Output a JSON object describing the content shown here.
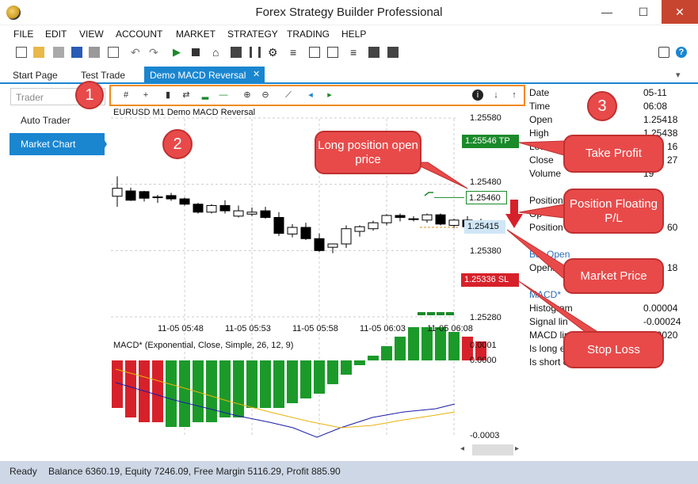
{
  "window": {
    "title": "Forex Strategy Builder Professional",
    "minimize": "—",
    "maximize": "☐",
    "close": "✕"
  },
  "menu": [
    "FILE",
    "EDIT",
    "VIEW",
    "ACCOUNT",
    "MARKET",
    "STRATEGY",
    "TRADING",
    "HELP"
  ],
  "tabs": {
    "start": "Start Page",
    "test": "Test Trade",
    "active": "Demo MACD Reversal",
    "close": "✕",
    "dropdown": "▾"
  },
  "sidebar": {
    "search_placeholder": "Trader",
    "items": [
      "Auto Trader",
      "Market Chart"
    ]
  },
  "chart": {
    "title": "EURUSD  M1 Demo MACD Reversal",
    "price_ticks": [
      "1.25580",
      "1.25480",
      "1.25380",
      "1.25280"
    ],
    "time_ticks": [
      "11-05 05:48",
      "11-05 05:53",
      "11-05 05:58",
      "11-05 06:03",
      "11-05 06:08"
    ],
    "tp_label": "1.25546 TP",
    "position_label": "1.25460",
    "market_label": "1.25415",
    "sl_label": "1.25336 SL",
    "indicator_title": "MACD* (Exponential, Close, Simple, 26, 12, 9)",
    "indicator_ticks": [
      "0.0001",
      "0.0000",
      "-0.0003"
    ]
  },
  "chart_data": {
    "type": "candlestick",
    "title": "EURUSD  M1 Demo MACD Reversal",
    "ylim": [
      1.2528,
      1.2558
    ],
    "candles": [
      {
        "o": 1.25462,
        "h": 1.25492,
        "l": 1.25446,
        "c": 1.25474
      },
      {
        "o": 1.2547,
        "h": 1.25475,
        "l": 1.25455,
        "c": 1.25456
      },
      {
        "o": 1.25469,
        "h": 1.2547,
        "l": 1.25454,
        "c": 1.25459
      },
      {
        "o": 1.2546,
        "h": 1.25464,
        "l": 1.25452,
        "c": 1.25461
      },
      {
        "o": 1.25463,
        "h": 1.25467,
        "l": 1.25455,
        "c": 1.25458
      },
      {
        "o": 1.25458,
        "h": 1.2546,
        "l": 1.25448,
        "c": 1.2545
      },
      {
        "o": 1.2545,
        "h": 1.25452,
        "l": 1.25436,
        "c": 1.25438
      },
      {
        "o": 1.25438,
        "h": 1.2545,
        "l": 1.25436,
        "c": 1.25448
      },
      {
        "o": 1.25448,
        "h": 1.25456,
        "l": 1.25436,
        "c": 1.2544
      },
      {
        "o": 1.25432,
        "h": 1.25448,
        "l": 1.2543,
        "c": 1.2544
      },
      {
        "o": 1.25435,
        "h": 1.25445,
        "l": 1.25432,
        "c": 1.25438
      },
      {
        "o": 1.2544,
        "h": 1.25446,
        "l": 1.25428,
        "c": 1.2543
      },
      {
        "o": 1.2543,
        "h": 1.25438,
        "l": 1.25402,
        "c": 1.25406
      },
      {
        "o": 1.25405,
        "h": 1.2542,
        "l": 1.254,
        "c": 1.25415
      },
      {
        "o": 1.25415,
        "h": 1.25422,
        "l": 1.25396,
        "c": 1.25398
      },
      {
        "o": 1.25398,
        "h": 1.25406,
        "l": 1.25378,
        "c": 1.2538
      },
      {
        "o": 1.25385,
        "h": 1.2539,
        "l": 1.25376,
        "c": 1.2539
      },
      {
        "o": 1.2539,
        "h": 1.25418,
        "l": 1.25384,
        "c": 1.25413
      },
      {
        "o": 1.25409,
        "h": 1.25418,
        "l": 1.25401,
        "c": 1.25416
      },
      {
        "o": 1.25413,
        "h": 1.25425,
        "l": 1.2541,
        "c": 1.25422
      },
      {
        "o": 1.25422,
        "h": 1.25435,
        "l": 1.25418,
        "c": 1.25433
      },
      {
        "o": 1.25433,
        "h": 1.25436,
        "l": 1.25424,
        "c": 1.2543
      },
      {
        "o": 1.25428,
        "h": 1.25432,
        "l": 1.25424,
        "c": 1.25427
      },
      {
        "o": 1.25426,
        "h": 1.25436,
        "l": 1.25422,
        "c": 1.25434
      },
      {
        "o": 1.25434,
        "h": 1.25436,
        "l": 1.25418,
        "c": 1.2542
      },
      {
        "o": 1.25418,
        "h": 1.25428,
        "l": 1.25414,
        "c": 1.25426
      },
      {
        "o": 1.25426,
        "h": 1.25432,
        "l": 1.25414,
        "c": 1.25416
      },
      {
        "o": 1.25415,
        "h": 1.25428,
        "l": 1.2541,
        "c": 1.25425
      }
    ],
    "macd_histogram": [
      -0.0001,
      -0.00012,
      -0.00013,
      -0.00013,
      -0.00014,
      -0.00014,
      -0.00013,
      -0.00013,
      -0.00012,
      -0.00012,
      -0.0001,
      -0.0001,
      -0.0001,
      -9e-05,
      -8e-05,
      -7e-05,
      -5e-05,
      -3e-05,
      -1e-05,
      1e-05,
      3e-05,
      5e-05,
      7e-05,
      7e-05,
      7e-05,
      6e-05,
      5e-05,
      4e-05
    ],
    "ind_ylim": [
      -0.0003,
      0.0001
    ]
  },
  "info": {
    "date_label": "Date",
    "date_val": "05-11",
    "time_label": "Time",
    "time_val": "06:08",
    "open_label": "Open",
    "open_val": "1.25418",
    "high_label": "High",
    "high_val": "1.25438",
    "low_label": "Low",
    "low_val": "16",
    "close_label": "Close",
    "close_val": "27",
    "volume_label": "Volume",
    "volume_val": "19",
    "position_label": "Position",
    "position2_label": "Op",
    "position3_label": "Position",
    "position3_val": "60",
    "bar_open_head": "Bar Open",
    "opening_label": "Opening",
    "opening_val": "18",
    "macd_head": "MACD*",
    "hist_label": "Histogram",
    "hist_val": "0.00004",
    "signal_label": "Signal lin",
    "signal_val": "-0.00024",
    "macdline_label": "MACD lin",
    "macdline_val": "0.00020",
    "islong_label": "Is long e",
    "isshort_label": "Is short e"
  },
  "callouts": {
    "long_pos": "Long position open price",
    "take_profit": "Take Profit",
    "floating": "Position Floating P/L",
    "market_price": "Market Price",
    "stop_loss": "Stop Loss",
    "n1": "1",
    "n2": "2",
    "n3": "3"
  },
  "status": {
    "ready": "Ready",
    "balance": "Balance 6360.19, Equity 7246.09, Free Margin 5116.29, Profit 885.90"
  },
  "colors": {
    "accent": "#1a86d0",
    "callout": "#e84a4a",
    "tp": "#1b8a2a",
    "sl": "#d7212a",
    "toolbar_outline": "#f08a1c"
  }
}
